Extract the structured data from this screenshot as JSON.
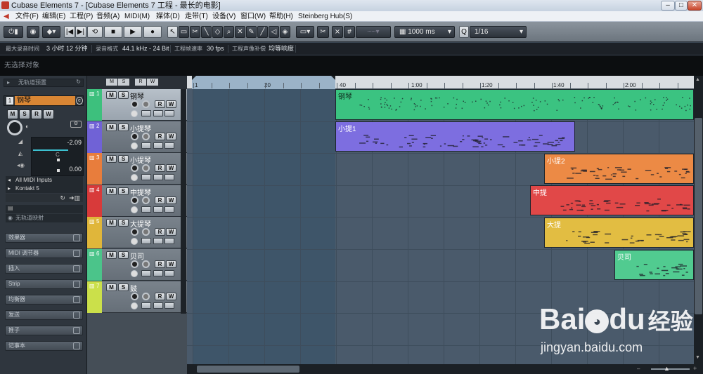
{
  "window": {
    "title": "Cubase Elements 7 - [Cubase Elements 7 工程 - 最长的电影]",
    "controls": [
      "–",
      "□",
      "✕"
    ]
  },
  "menu": [
    "文件(F)",
    "编辑(E)",
    "工程(P)",
    "音频(A)",
    "MIDI(M)",
    "媒体(D)",
    "走带(T)",
    "设备(V)",
    "窗口(W)",
    "帮助(H)",
    "Steinberg Hub(S)"
  ],
  "toolbar": {
    "timebase": "1000 ms",
    "quantize_label": "Q",
    "quantize_value": "1/16"
  },
  "infobar": {
    "record_time_label": "最大录音时间",
    "record_time_value": "3 小时 12 分钟",
    "format_label": "录音格式",
    "format_value": "44.1 kHz - 24 Bit",
    "frame_label": "工程帧速率",
    "frame_value": "30 fps",
    "pan_label": "工程声像补偿",
    "pan_value": "均等响度"
  },
  "no_selection": "无选择对象",
  "inspector": {
    "header": "无轨道预置",
    "track_name": "钢琴",
    "volume": "-2.09",
    "pan_label": "C",
    "delay": "0.00",
    "input": "All MIDI Inputs",
    "output": "Kontakt 5",
    "program": "无轨道映射",
    "sections": [
      "效果器",
      "MIDI 调节器",
      "插入",
      "Strip",
      "均衡器",
      "发送",
      "推子",
      "记事本"
    ]
  },
  "tracks": [
    {
      "num": "1",
      "name": "钢琴",
      "color": "#3dc07d",
      "selected": true
    },
    {
      "num": "2",
      "name": "小提琴",
      "color": "#7062d6",
      "selected": false
    },
    {
      "num": "3",
      "name": "小提琴",
      "color": "#e87d3c",
      "selected": false
    },
    {
      "num": "4",
      "name": "中提琴",
      "color": "#d83a3a",
      "selected": false
    },
    {
      "num": "5",
      "name": "大提琴",
      "color": "#e0b63a",
      "selected": false
    },
    {
      "num": "6",
      "name": "贝司",
      "color": "#4bc48a",
      "selected": false
    },
    {
      "num": "7",
      "name": "鼓",
      "color": "#cbe04a",
      "selected": false
    }
  ],
  "ruler": [
    "1",
    "20",
    "40",
    "1:00",
    "1:20",
    "1:40",
    "2:00"
  ],
  "parts": [
    {
      "label": "钢琴",
      "color": "#3bc381"
    },
    {
      "label": "小提1",
      "color": "#7d6ee0"
    },
    {
      "label": "小提2",
      "color": "#ec8a45"
    },
    {
      "label": "中提",
      "color": "#e14848"
    },
    {
      "label": "大提",
      "color": "#e2bd42"
    },
    {
      "label": "贝司",
      "color": "#51cb90"
    }
  ],
  "watermark": {
    "brand": "Bai",
    "brand2": "du",
    "cn": "经验",
    "url": "jingyan.baidu.com"
  }
}
